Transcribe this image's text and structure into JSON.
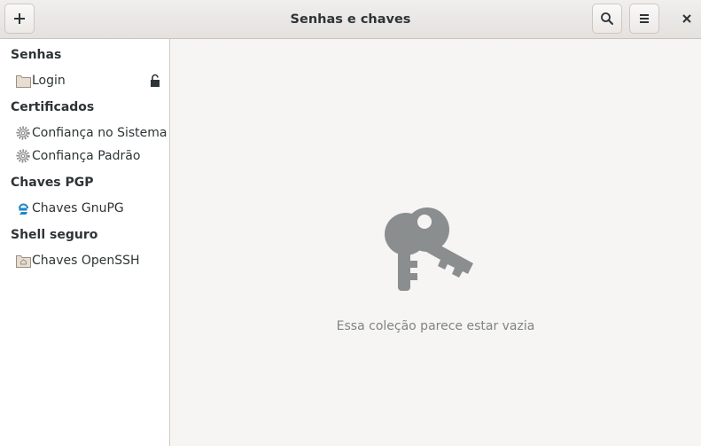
{
  "window": {
    "title": "Senhas e chaves"
  },
  "sidebar": {
    "sections": [
      {
        "label": "Senhas",
        "items": [
          {
            "label": "Login",
            "icon": "folder-icon",
            "locked": true
          }
        ]
      },
      {
        "label": "Certificados",
        "items": [
          {
            "label": "Confiança no Sistema",
            "icon": "gear-icon"
          },
          {
            "label": "Confiança Padrão",
            "icon": "gear-icon"
          }
        ]
      },
      {
        "label": "Chaves PGP",
        "items": [
          {
            "label": "Chaves GnuPG",
            "icon": "gnupg-icon"
          }
        ]
      },
      {
        "label": "Shell seguro",
        "items": [
          {
            "label": "Chaves OpenSSH",
            "icon": "home-folder-icon"
          }
        ]
      }
    ]
  },
  "main": {
    "empty_message": "Essa coleção parece estar vazia",
    "empty_icon": "keys-icon"
  },
  "colors": {
    "icon_gray": "#8b8e8f",
    "text": "#2e3436",
    "muted_text": "#7f8485"
  }
}
